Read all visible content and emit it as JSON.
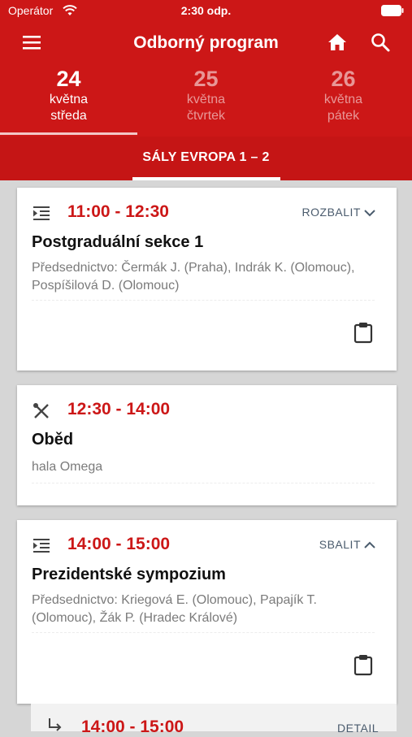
{
  "status_bar": {
    "carrier": "Operátor",
    "time": "2:30 odp."
  },
  "app_bar": {
    "title": "Odborný program"
  },
  "days": [
    {
      "num": "24",
      "month": "května",
      "weekday": "středa",
      "active": true
    },
    {
      "num": "25",
      "month": "května",
      "weekday": "čtvrtek",
      "active": false
    },
    {
      "num": "26",
      "month": "května",
      "weekday": "pátek",
      "active": false
    }
  ],
  "hall_tab": {
    "label": "SÁLY EVROPA 1 – 2"
  },
  "sessions": [
    {
      "time": "11:00 - 12:30",
      "toggle": "ROZBALIT",
      "title": "Postgraduální sekce 1",
      "subtitle": "Předsednictvo: Čermák J. (Praha), Indrák K. (Olomouc), Pospíšilová D. (Olomouc)"
    },
    {
      "time": "12:30 - 14:00",
      "title": "Oběd",
      "subtitle": "hala Omega"
    },
    {
      "time": "14:00 - 15:00",
      "toggle": "SBALIT",
      "title": "Prezidentské sympozium",
      "subtitle": "Předsednictvo: Kriegová E. (Olomouc), Papajík T. (Olomouc), Žák P. (Hradec Králové)"
    }
  ],
  "sub_item": {
    "time": "14:00 - 15:00",
    "detail": "DETAIL"
  },
  "colors": {
    "primary": "#cc1717",
    "background": "#d6d6d6"
  }
}
